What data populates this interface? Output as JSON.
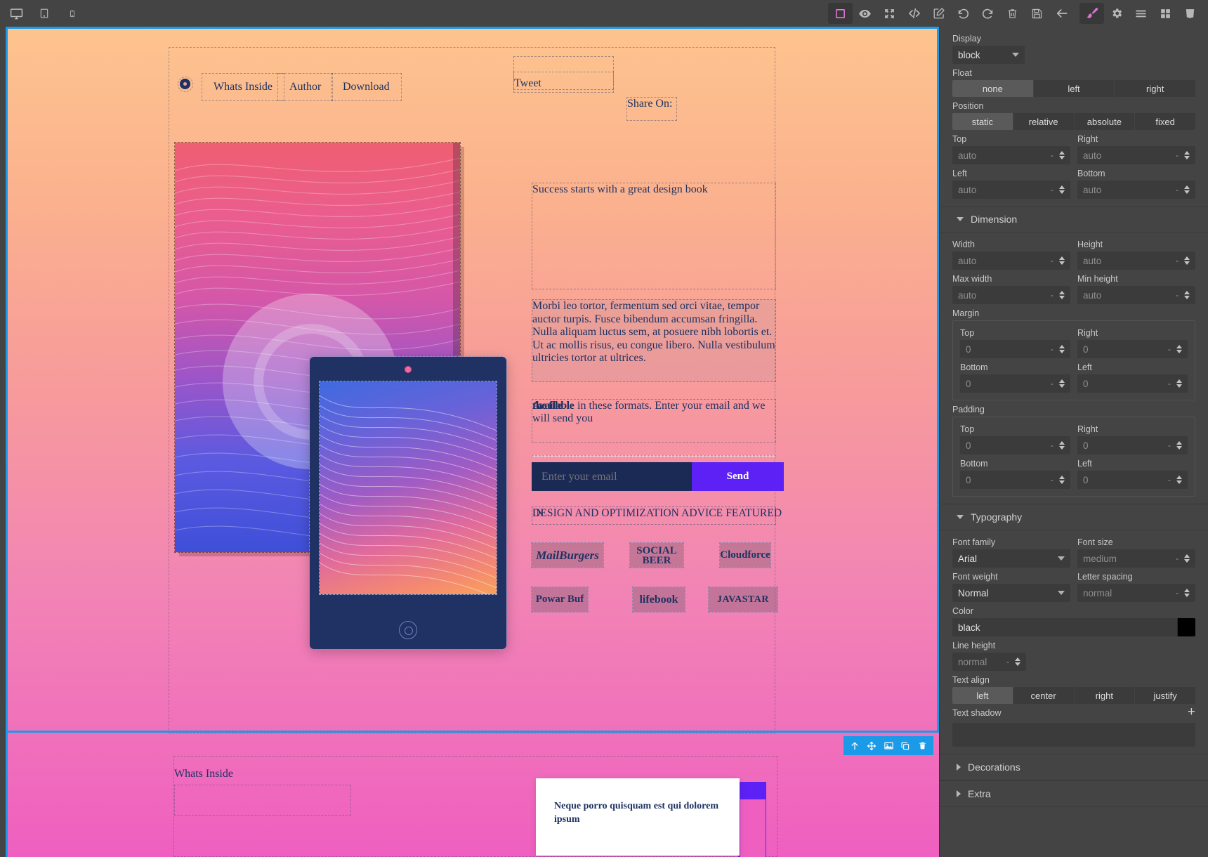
{
  "toolbar": {
    "devices": [
      {
        "name": "desktop-icon",
        "label": "Desktop"
      },
      {
        "name": "tablet-icon",
        "label": "Tablet"
      },
      {
        "name": "mobile-icon",
        "label": "Mobile"
      }
    ],
    "actions": [
      {
        "name": "sw-visibility-icon",
        "label": "Toggle borders",
        "active": true
      },
      {
        "name": "preview-eye-icon",
        "label": "Preview"
      },
      {
        "name": "fullscreen-icon",
        "label": "Fullscreen"
      },
      {
        "name": "export-code-icon",
        "label": "View code"
      },
      {
        "name": "edit-canvas-icon",
        "label": "Edit"
      },
      {
        "name": "undo-icon",
        "label": "Undo"
      },
      {
        "name": "redo-icon",
        "label": "Redo"
      },
      {
        "name": "delete-icon",
        "label": "Clear canvas"
      },
      {
        "name": "save-icon",
        "label": "Save"
      },
      {
        "name": "back-arrow-icon",
        "label": "Back"
      }
    ],
    "panels": [
      {
        "name": "paint-brush-icon",
        "label": "Style Manager",
        "active": true
      },
      {
        "name": "gear-icon",
        "label": "Settings"
      },
      {
        "name": "layers-icon",
        "label": "Layer Manager"
      },
      {
        "name": "blocks-icon",
        "label": "Blocks"
      },
      {
        "name": "css-logo-icon",
        "label": "CSS"
      }
    ]
  },
  "canvas": {
    "nav": {
      "logo_alt": "logo-mark",
      "items": [
        "Whats Inside",
        "Author",
        "Download"
      ]
    },
    "share": {
      "label": "Share On:",
      "tweet": "Tweet"
    },
    "headline": "Success starts with a great design book",
    "body_copy": "Morbi leo tortor, fermentum sed orci vitae, tempor auctor turpis. Fusce bibendum accumsan fringilla. Nulla aliquam luctus sem, at posuere nibh lobortis et. Ut ac mollis risus, eu congue libero. Nulla vestibulum ultricies tortor at ultrices.",
    "availability": {
      "overlap_a": "Available",
      "overlap_b": "the file",
      "rest": " in these formats. Enter your email and we will send you"
    },
    "form": {
      "email_placeholder": "Enter your email",
      "email_value": "",
      "send_label": "Send"
    },
    "featured_heading": "DESIGN AND OPTIMIZATION ADVICE FEATURED",
    "featured_heading_overlay": "IN",
    "logos": [
      [
        "MailBurgers",
        "SOCIAL BEER",
        "Cloudforce"
      ],
      [
        "Powar Buf",
        "lifebook",
        "JAVASTAR"
      ]
    ],
    "bottom": {
      "whats_inside": "Whats Inside",
      "card_text": "Neque porro quisquam est qui dolorem ipsum"
    }
  },
  "style_manager": {
    "general": {
      "display": {
        "label": "Display",
        "value": "block"
      },
      "float": {
        "label": "Float",
        "options": [
          "none",
          "left",
          "right"
        ],
        "selected": "none"
      },
      "position": {
        "label": "Position",
        "options": [
          "static",
          "relative",
          "absolute",
          "fixed"
        ],
        "selected": "static"
      },
      "top": {
        "label": "Top",
        "value": "auto",
        "unit": "-"
      },
      "right": {
        "label": "Right",
        "value": "auto",
        "unit": "-"
      },
      "left": {
        "label": "Left",
        "value": "auto",
        "unit": "-"
      },
      "bottom": {
        "label": "Bottom",
        "value": "auto",
        "unit": "-"
      }
    },
    "dimension": {
      "title": "Dimension",
      "width": {
        "label": "Width",
        "value": "auto",
        "unit": "-"
      },
      "height": {
        "label": "Height",
        "value": "auto",
        "unit": "-"
      },
      "max_width": {
        "label": "Max width",
        "value": "auto",
        "unit": "-"
      },
      "min_height": {
        "label": "Min height",
        "value": "auto",
        "unit": "-"
      },
      "margin": {
        "label": "Margin",
        "top": {
          "label": "Top",
          "value": "0",
          "unit": "-"
        },
        "right": {
          "label": "Right",
          "value": "0",
          "unit": "-"
        },
        "bottom": {
          "label": "Bottom",
          "value": "0",
          "unit": "-"
        },
        "left": {
          "label": "Left",
          "value": "0",
          "unit": "-"
        }
      },
      "padding": {
        "label": "Padding",
        "top": {
          "label": "Top",
          "value": "0",
          "unit": "-"
        },
        "right": {
          "label": "Right",
          "value": "0",
          "unit": "-"
        },
        "bottom": {
          "label": "Bottom",
          "value": "0",
          "unit": "-"
        },
        "left": {
          "label": "Left",
          "value": "0",
          "unit": "-"
        }
      }
    },
    "typography": {
      "title": "Typography",
      "font_family": {
        "label": "Font family",
        "value": "Arial"
      },
      "font_size": {
        "label": "Font size",
        "value": "medium",
        "unit": "-"
      },
      "font_weight": {
        "label": "Font weight",
        "value": "Normal"
      },
      "letter_spacing": {
        "label": "Letter spacing",
        "value": "normal",
        "unit": "-"
      },
      "color": {
        "label": "Color",
        "value": "black",
        "swatch": "#000000"
      },
      "line_height": {
        "label": "Line height",
        "value": "normal",
        "unit": "-"
      },
      "text_align": {
        "label": "Text align",
        "options": [
          "left",
          "center",
          "right",
          "justify"
        ],
        "selected": "left"
      },
      "text_shadow": {
        "label": "Text shadow",
        "add": "+"
      }
    },
    "decorations": {
      "title": "Decorations"
    },
    "extra": {
      "title": "Extra"
    }
  },
  "component_toolbar": {
    "items": [
      {
        "name": "select-parent-icon",
        "label": "Select parent"
      },
      {
        "name": "move-icon",
        "label": "Move"
      },
      {
        "name": "image-icon",
        "label": "Replace image"
      },
      {
        "name": "copy-icon",
        "label": "Duplicate"
      },
      {
        "name": "trash-icon",
        "label": "Delete"
      }
    ]
  },
  "colors": {
    "accent_blue": "#1b9ae8",
    "accent_purple": "#5d21f5",
    "brand_pink": "#e87ab0",
    "panel_bg": "#444444",
    "field_bg": "#3b3b3b",
    "navy": "#1f3263"
  }
}
